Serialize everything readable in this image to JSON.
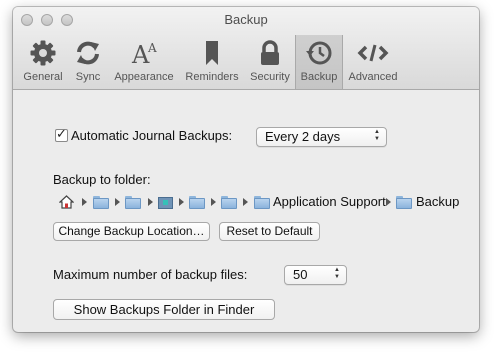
{
  "window": {
    "title": "Backup"
  },
  "toolbar": {
    "items": [
      {
        "label": "General",
        "icon": "gear-icon"
      },
      {
        "label": "Sync",
        "icon": "sync-icon"
      },
      {
        "label": "Appearance",
        "icon": "font-size-icon"
      },
      {
        "label": "Reminders",
        "icon": "bookmark-icon"
      },
      {
        "label": "Security",
        "icon": "lock-icon"
      },
      {
        "label": "Backup",
        "icon": "clock-icon",
        "active": true
      },
      {
        "label": "Advanced",
        "icon": "code-icon"
      }
    ]
  },
  "backup": {
    "auto_label": "Automatic Journal Backups:",
    "auto_checked": true,
    "frequency_value": "Every 2 days",
    "folder_label": "Backup to folder:",
    "path": {
      "app_support_label": "Application Support",
      "backup_label": "Backup"
    },
    "change_location_label": "Change Backup Location…",
    "reset_label": "Reset to Default",
    "max_files_label": "Maximum number of backup files:",
    "max_files_value": "50",
    "show_folder_label": "Show Backups Folder in Finder"
  },
  "colors": {
    "window_bg": "#ececec",
    "folder_blue": "#8bb3dc"
  }
}
